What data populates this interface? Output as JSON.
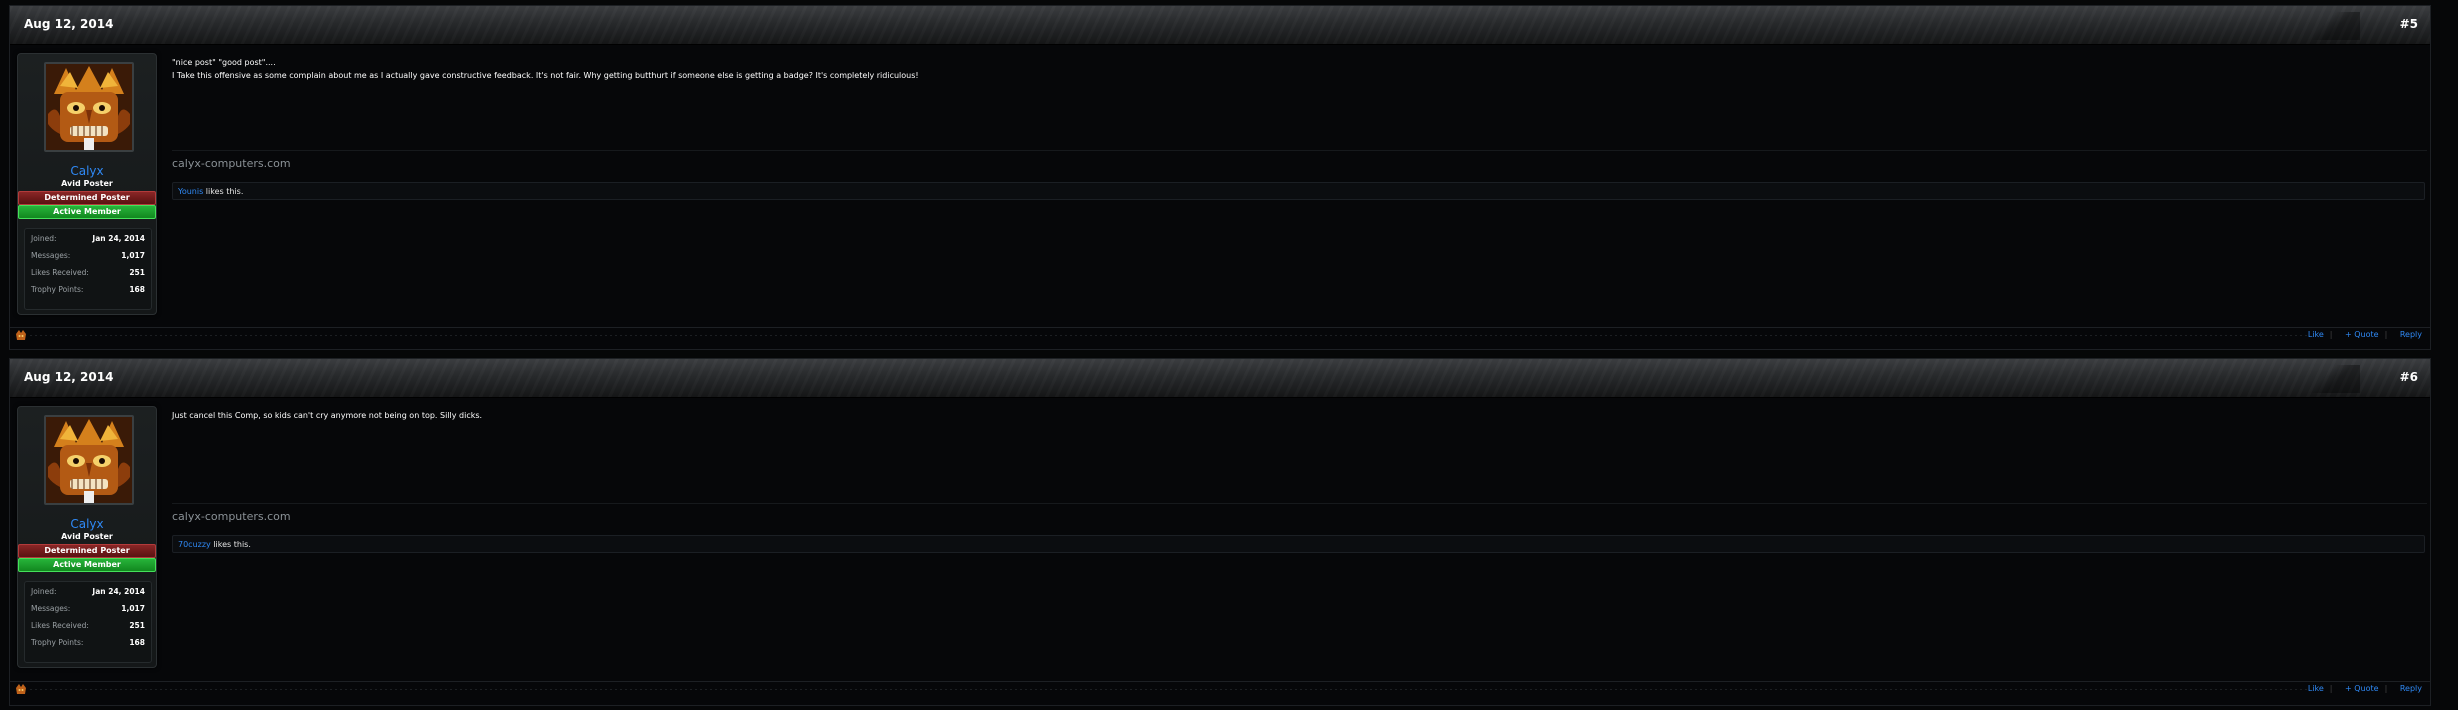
{
  "posts": [
    {
      "date": "Aug 12, 2014",
      "number": "#5",
      "message_lines": [
        "\"nice post\" \"good post\"....",
        "I Take this offensive as some complain about me as I actually gave constructive feedback. It's not fair. Why getting butthurt if someone else is getting a badge? It's completely ridiculous!"
      ],
      "signature": "calyx-computers.com",
      "likes": {
        "user": "Younis",
        "text": " likes this."
      },
      "actions": {
        "like": "Like",
        "quote": "+ Quote",
        "reply": "Reply"
      }
    },
    {
      "date": "Aug 12, 2014",
      "number": "#6",
      "message_lines": [
        "Just cancel this Comp, so kids can't cry anymore not being on top. Silly dicks."
      ],
      "signature": "calyx-computers.com",
      "likes": {
        "user": "70cuzzy",
        "text": " likes this."
      },
      "actions": {
        "like": "Like",
        "quote": "+ Quote",
        "reply": "Reply"
      }
    }
  ],
  "user": {
    "name": "Calyx",
    "title": "Avid Poster",
    "banner_red": "Determined Poster",
    "banner_green": "Active Member",
    "stats": [
      {
        "label": "Joined:",
        "value": "Jan 24, 2014"
      },
      {
        "label": "Messages:",
        "value": "1,017"
      },
      {
        "label": "Likes Received:",
        "value": "251"
      },
      {
        "label": "Trophy Points:",
        "value": "168"
      }
    ],
    "avatar_icon": "tiki-mask-avatar"
  },
  "colors": {
    "link": "#2f89f5",
    "banner_red": "#7a1c1c",
    "banner_green": "#1fa32f",
    "background": "#060708"
  }
}
